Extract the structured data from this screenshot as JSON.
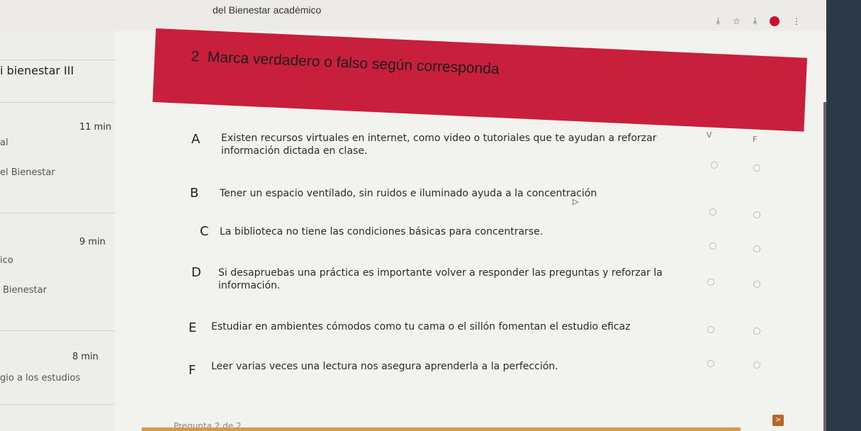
{
  "browser": {
    "tab_title": "del Bienestar académico",
    "icons": [
      "download-icon",
      "star-icon",
      "download-icon",
      "profile-icon",
      "menu-icon"
    ]
  },
  "sidebar": {
    "title": "i bienestar III",
    "items": [
      {
        "time": "11 min",
        "line1": "al",
        "line2": "el Bienestar"
      },
      {
        "time": "9 min",
        "line1": "ico",
        "line2": "Bienestar"
      },
      {
        "time": "8 min",
        "line1": "",
        "line2": "gio a los estudios"
      }
    ]
  },
  "question": {
    "number": "2",
    "title": "Marca verdadero o falso según corresponda",
    "col_true": "V",
    "col_false": "F"
  },
  "items": [
    {
      "letter": "A",
      "text": "Existen recursos virtuales en internet, como video o tutoriales que te ayudan a reforzar información dictada en clase."
    },
    {
      "letter": "B",
      "text": "Tener un espacio ventilado, sin ruidos e iluminado ayuda a la concentración"
    },
    {
      "letter": "C",
      "text": "La biblioteca no tiene las condiciones básicas para concentrarse."
    },
    {
      "letter": "D",
      "text": "Si desapruebas una práctica es importante volver a responder las preguntas y reforzar la información."
    },
    {
      "letter": "E",
      "text": "Estudiar en ambientes cómodos como tu cama o el sillón fomentan el estudio eficaz"
    },
    {
      "letter": "F",
      "text": "Leer varias veces una lectura nos asegura aprenderla a la perfección."
    }
  ],
  "footer": {
    "pagination": "Pregunta 2 de 2",
    "next": ">"
  }
}
